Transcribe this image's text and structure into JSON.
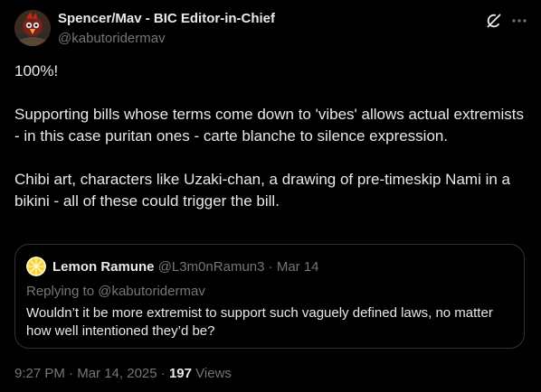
{
  "author": {
    "display_name": "Spencer/Mav - BIC Editor-in-Chief",
    "handle": "@kabutoridermav",
    "avatar_icon": "red-bird-avatar"
  },
  "header_icons": [
    "grok-icon",
    "more-icon"
  ],
  "tweet": {
    "paragraphs": [
      "100%!",
      "Supporting bills whose terms come down to 'vibes' allows actual extremists - in this case puritan ones - carte blanche to silence expression.",
      "Chibi art, characters like Uzaki-chan, a drawing of pre-timeskip Nami in a bikini - all of these could trigger the bill."
    ]
  },
  "quote": {
    "avatar_icon": "lemon-slice-avatar",
    "display_name": "Lemon Ramune",
    "handle": "@L3m0nRamun3",
    "separator": "·",
    "date": "Mar 14",
    "replying_to": "Replying to @kabutoridermav",
    "text": "Wouldn’t it be more extremist to support such vaguely defined laws, no matter how well intentioned they’d be?"
  },
  "footer": {
    "time": "9:27 PM",
    "separator": "·",
    "date": "Mar 14, 2025",
    "views_count": "197",
    "views_label": "Views"
  },
  "colors": {
    "background": "#000000",
    "primary_text": "#e7e9ea",
    "secondary_text": "#71767b",
    "border": "#2f3336"
  }
}
